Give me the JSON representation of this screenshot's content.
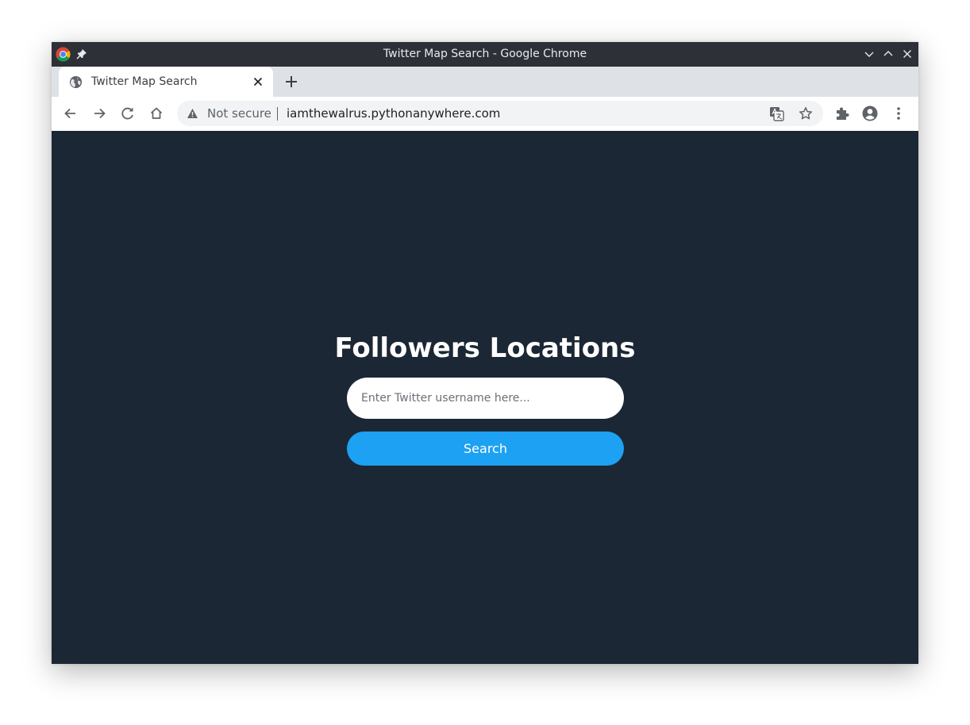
{
  "window": {
    "title": "Twitter Map Search - Google Chrome"
  },
  "tab": {
    "label": "Twitter Map Search"
  },
  "omnibox": {
    "security_label": "Not secure",
    "url": "iamthewalrus.pythonanywhere.com"
  },
  "page": {
    "heading": "Followers Locations",
    "search_placeholder": "Enter Twitter username here...",
    "search_value": "",
    "search_button_label": "Search"
  },
  "colors": {
    "page_background": "#1b2735",
    "accent": "#1da1f2",
    "titlebar": "#2e3037"
  },
  "icons": [
    "chrome-logo-icon",
    "pin-icon",
    "minimize-icon",
    "maximize-icon",
    "close-window-icon",
    "globe-icon",
    "tab-close-icon",
    "new-tab-icon",
    "back-icon",
    "forward-icon",
    "reload-icon",
    "home-icon",
    "warning-icon",
    "translate-icon",
    "star-icon",
    "extensions-icon",
    "profile-icon",
    "menu-icon"
  ]
}
